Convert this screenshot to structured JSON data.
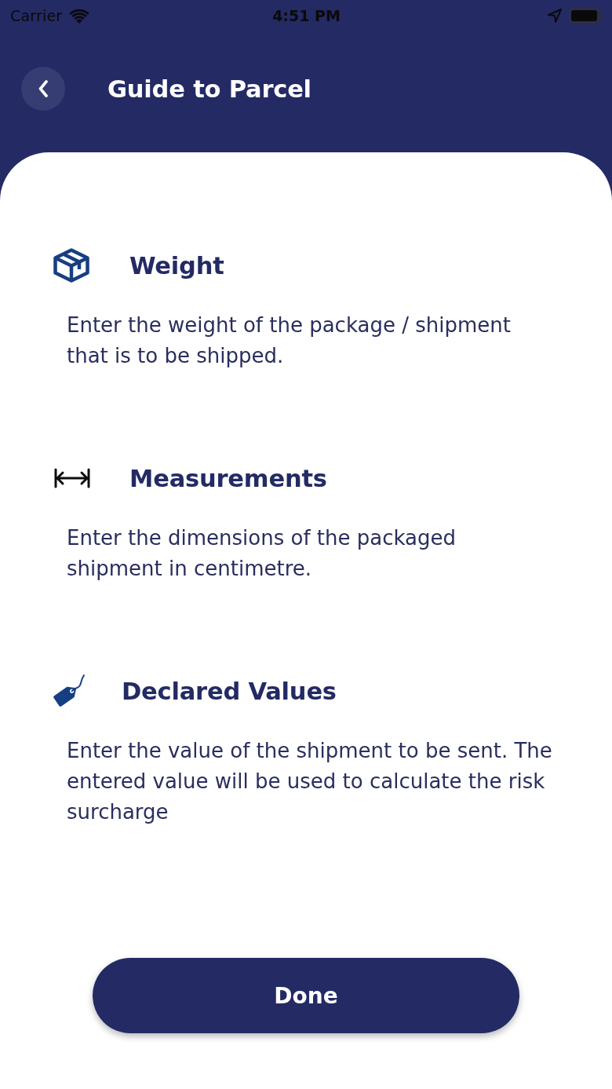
{
  "status_bar": {
    "carrier": "Carrier",
    "time": "4:51 PM"
  },
  "header": {
    "title": "Guide to Parcel"
  },
  "sections": [
    {
      "kind": "box",
      "title": "Weight",
      "description": "Enter the weight of the package / shipment\nthat is to be shipped."
    },
    {
      "kind": "arrows",
      "title": "Measurements",
      "description": "Enter the dimensions of the packaged\nshipment in centimetre."
    },
    {
      "kind": "tag",
      "title": "Declared Values",
      "description": "Enter the value of the shipment to be sent. The\nentered value will be used to calculate the risk\nsurcharge"
    }
  ],
  "done_button": {
    "label": "Done"
  }
}
